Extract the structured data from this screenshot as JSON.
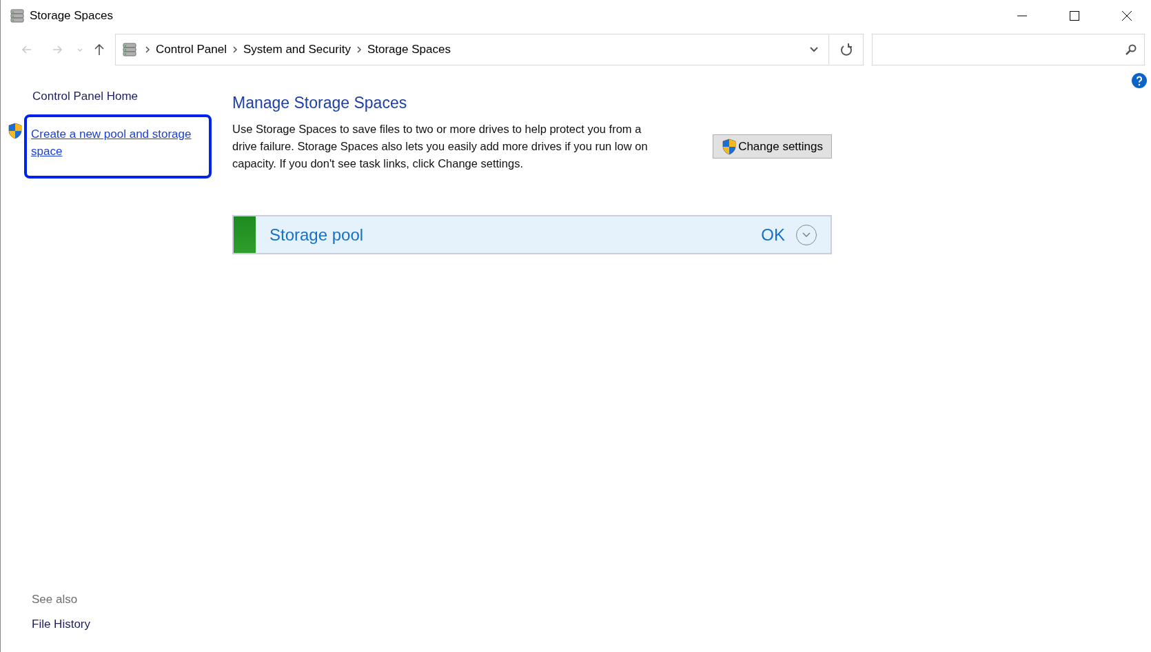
{
  "window": {
    "title": "Storage Spaces"
  },
  "navigation": [
    {
      "kind": "back",
      "disabled": true
    },
    {
      "kind": "forward",
      "disabled": true
    },
    {
      "kind": "recent",
      "disabled": true
    },
    {
      "kind": "up",
      "disabled": false
    }
  ],
  "address_bar": {
    "breadcrumbs": [
      "Control Panel",
      "System and Security",
      "Storage Spaces"
    ]
  },
  "sidebar": {
    "home": "Control Panel Home",
    "tasks": [
      {
        "label": "Create a new pool and storage space",
        "highlighted": true
      }
    ],
    "see_also_title": "See also",
    "see_also": [
      "File History"
    ]
  },
  "main": {
    "heading": "Manage Storage Spaces",
    "description": "Use Storage Spaces to save files to two or more drives to help protect you from a drive failure. Storage Spaces also lets you easily add more drives if you run low on capacity. If you don't see task links, click Change settings.",
    "button": "Change settings",
    "pools": [
      {
        "name": "Storage pool",
        "status": "OK",
        "expanded": false,
        "color": "#2e9e2e"
      }
    ]
  }
}
